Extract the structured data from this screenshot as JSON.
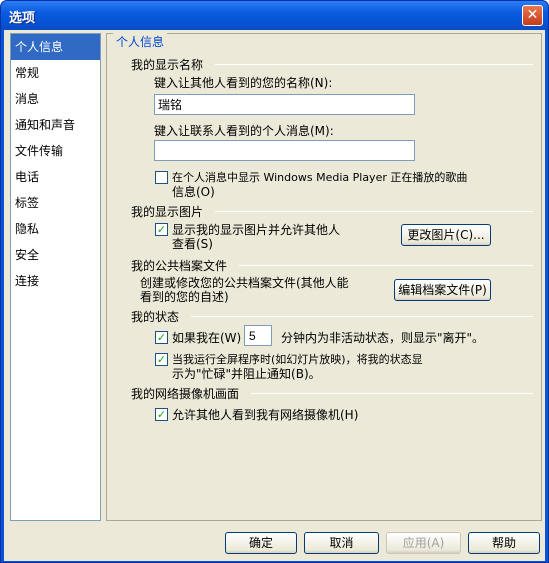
{
  "window": {
    "title": "选项",
    "close_label": "✕"
  },
  "nav": {
    "items": [
      "个人信息",
      "常规",
      "消息",
      "通知和声音",
      "文件传输",
      "电话",
      "标签",
      "隐私",
      "安全",
      "连接"
    ],
    "selected_index": 0
  },
  "panel": {
    "title": "个人信息",
    "display_name": {
      "heading": "我的显示名称",
      "name_label": "键入让其他人看到的您的名称(N):",
      "name_value": "瑞铭",
      "message_label": "键入让联系人看到的个人消息(M):",
      "message_value": "",
      "show_music_label_line1": "在个人消息中显示 Windows Media Player 正在播放的歌曲",
      "show_music_label_line2": "信息(O)",
      "show_music_checked": false
    },
    "display_picture": {
      "heading": "我的显示图片",
      "show_label_line1": "显示我的显示图片并允许其他人",
      "show_label_line2": "查看(S)",
      "show_checked": true,
      "change_button": "更改图片(C)..."
    },
    "public_profile": {
      "heading": "我的公共档案文件",
      "desc_line1": "创建或修改您的公共档案文件(其他人能",
      "desc_line2": "看到的您的自述)",
      "edit_button": "编辑档案文件(P)"
    },
    "status": {
      "heading": "我的状态",
      "idle_prefix": "如果我在(W)",
      "idle_minutes": "5",
      "idle_suffix": "分钟内为非活动状态，则显示\"离开\"。",
      "idle_checked": true,
      "fullscreen_line1": "当我运行全屏程序时(如幻灯片放映)，将我的状态显",
      "fullscreen_line2": "示为\"忙碌\"并阻止通知(B)。",
      "fullscreen_checked": true
    },
    "webcam": {
      "heading": "我的网络摄像机画面",
      "allow_label": "允许其他人看到我有网络摄像机(H)",
      "allow_checked": true
    }
  },
  "buttons": {
    "ok": "确定",
    "cancel": "取消",
    "apply": "应用(A)",
    "help": "帮助"
  }
}
